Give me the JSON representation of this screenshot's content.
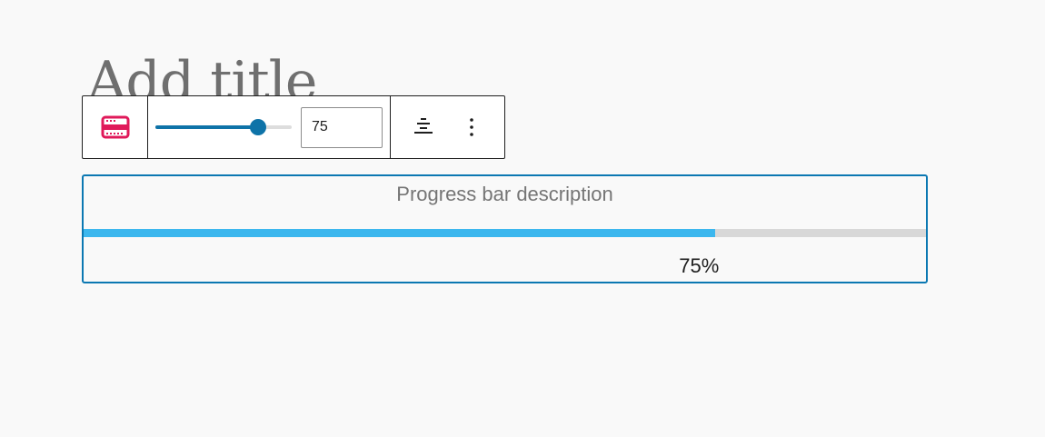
{
  "editor": {
    "title_placeholder": "Add title"
  },
  "toolbar": {
    "block_icon": "progress-bar-icon",
    "slider_value": 75,
    "slider_min": 0,
    "slider_max": 100,
    "input_value": "75",
    "align_icon": "align-center-icon",
    "more_icon": "more-vertical-icon"
  },
  "progress_block": {
    "description": "Progress bar description",
    "percent": 75,
    "percent_label": "75%"
  },
  "colors": {
    "accent": "#0e73a8",
    "block_icon": "#e0195a",
    "progress_fill": "#3cb7ee",
    "progress_track": "#d8d8d8",
    "selection_border": "#0b78b2"
  }
}
